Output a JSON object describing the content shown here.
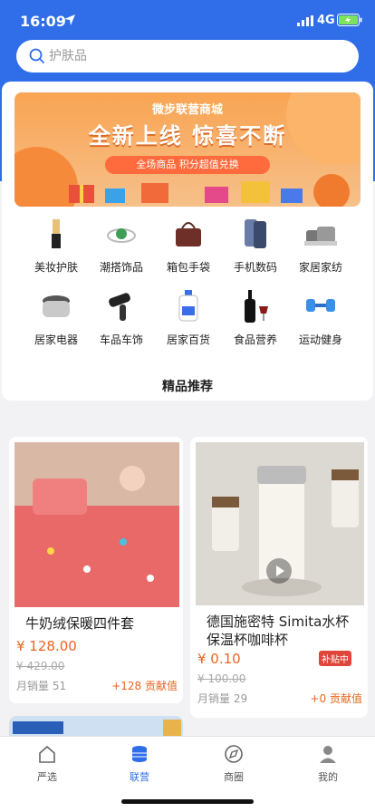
{
  "status": {
    "time": "16:09",
    "network": "4G"
  },
  "search": {
    "placeholder": "护肤品"
  },
  "banner": {
    "subtitle": "微步联营商城",
    "title": "全新上线 惊喜不断",
    "pill": "全场商品 积分超值兑换"
  },
  "categories": [
    {
      "label": "美妆护肤",
      "icon": "lipstick-icon"
    },
    {
      "label": "潮搭饰品",
      "icon": "ring-icon"
    },
    {
      "label": "箱包手袋",
      "icon": "handbag-icon"
    },
    {
      "label": "手机数码",
      "icon": "phone-icon"
    },
    {
      "label": "家居家纺",
      "icon": "pillow-icon"
    },
    {
      "label": "居家电器",
      "icon": "rice-cooker-icon"
    },
    {
      "label": "车品车饰",
      "icon": "car-vacuum-icon"
    },
    {
      "label": "居家百货",
      "icon": "detergent-icon"
    },
    {
      "label": "食品营养",
      "icon": "wine-icon"
    },
    {
      "label": "运动健身",
      "icon": "dumbbell-icon"
    }
  ],
  "recommend": {
    "title": "精品推荐"
  },
  "products": [
    {
      "name": "牛奶绒保暖四件套",
      "price": "¥ 128.00",
      "orig": "¥ 429.00",
      "sales": "月销量 51",
      "contrib": "+128 贡献值"
    },
    {
      "name": "德国施密特 Simita水杯保温杯咖啡杯",
      "price": "¥ 0.10",
      "orig": "¥ 100.00",
      "sales": "月销量 29",
      "contrib": "+0 贡献值",
      "tag": "补贴中"
    }
  ],
  "tabs": [
    {
      "label": "严选",
      "icon": "home-icon"
    },
    {
      "label": "联营",
      "icon": "coins-icon"
    },
    {
      "label": "商圈",
      "icon": "compass-icon"
    },
    {
      "label": "我的",
      "icon": "user-icon"
    }
  ],
  "colors": {
    "primary": "#2f6ee8",
    "price": "#e8651f",
    "tag": "#e0453a"
  }
}
